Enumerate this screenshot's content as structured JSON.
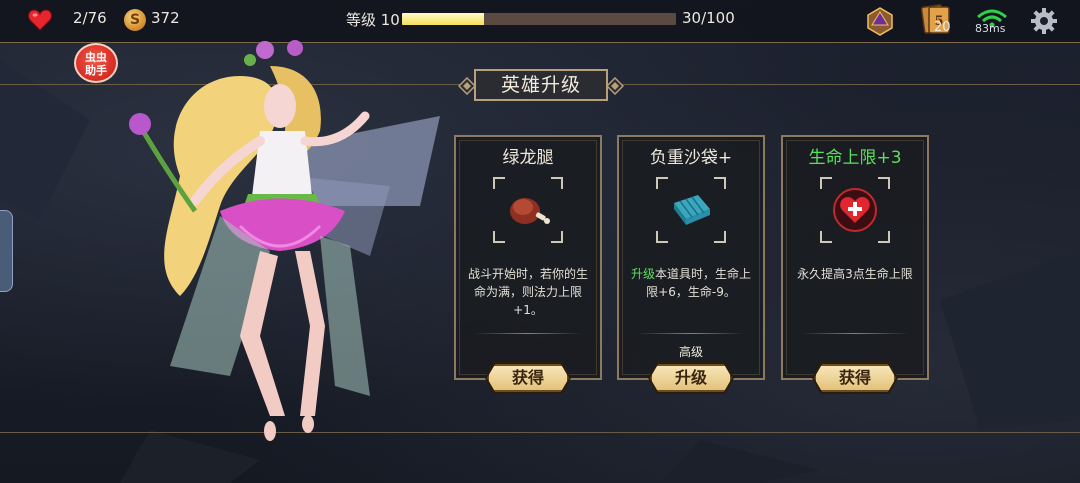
{
  "topbar": {
    "hp": "2/76",
    "coin_symbol": "S",
    "gold": "372",
    "level_label": "等级 10",
    "xp_text": "30/100",
    "xp_progress": 0.3,
    "cards_count": "20",
    "ping": "83ms"
  },
  "helper": {
    "line1": "虫虫",
    "line2": "助手"
  },
  "title": "英雄升级",
  "cards": [
    {
      "title": "绿龙腿",
      "desc_prefix": "",
      "desc": "战斗开始时，若你的生命为满，则法力上限+1。",
      "rarity": "",
      "button": "获得"
    },
    {
      "title": "负重沙袋+",
      "desc_prefix": "升级",
      "desc": "本道具时，生命上限+6，生命-9。",
      "rarity": "高级",
      "button": "升级"
    },
    {
      "title": "生命上限+3",
      "desc_prefix": "",
      "desc": "永久提高3点生命上限",
      "rarity": "",
      "button": "获得"
    }
  ],
  "colors": {
    "accent_green": "#5be05e",
    "button_gold": "#e3c27a",
    "xp_fill": "#f4e05a"
  }
}
